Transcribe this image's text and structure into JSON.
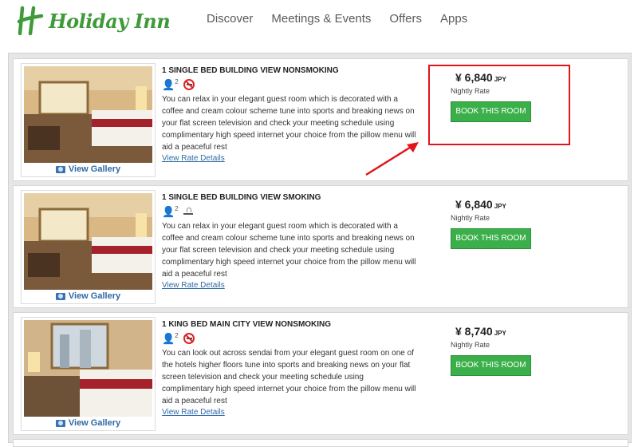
{
  "brand": {
    "name": "Holiday Inn",
    "color": "#3f9a3a"
  },
  "nav": [
    "Discover",
    "Meetings & Events",
    "Offers",
    "Apps"
  ],
  "rooms": [
    {
      "title": "1 SINGLE BED BUILDING VIEW NONSMOKING",
      "occupancy": "2",
      "smoking_icon": "no-smoking-icon",
      "description": "You can relax in your elegant guest room which is decorated with a coffee and cream colour scheme tune into sports and breaking news on your flat screen television and check your meeting schedule using complimentary high speed internet your choice from the pillow menu will aid a peaceful rest",
      "rate_link": "View Rate Details",
      "gallery": "View Gallery",
      "price": "¥ 6,840",
      "currency": "JPY",
      "price_note": "Nightly Rate",
      "book_label": "BOOK THIS ROOM"
    },
    {
      "title": "1 SINGLE BED BUILDING VIEW SMOKING",
      "occupancy": "2",
      "smoking_icon": "smoking-icon",
      "description": "You can relax in your elegant guest room which is decorated with a coffee and cream colour scheme tune into sports and breaking news on your flat screen television and check your meeting schedule using complimentary high speed internet your choice from the pillow menu will aid a peaceful rest",
      "rate_link": "View Rate Details",
      "gallery": "View Gallery",
      "price": "¥ 6,840",
      "currency": "JPY",
      "price_note": "Nightly Rate",
      "book_label": "BOOK THIS ROOM"
    },
    {
      "title": "1 KING BED MAIN CITY VIEW NONSMOKING",
      "occupancy": "2",
      "smoking_icon": "no-smoking-icon",
      "description": "You can look out across sendai from your elegant guest room on one of the hotels higher floors tune into sports and breaking news on your flat screen television and check your meeting schedule using complimentary high speed internet your choice from the pillow menu will aid a peaceful rest",
      "rate_link": "View Rate Details",
      "gallery": "View Gallery",
      "price": "¥ 8,740",
      "currency": "JPY",
      "price_note": "Nightly Rate",
      "book_label": "BOOK THIS ROOM"
    }
  ],
  "colors": {
    "accent_green": "#3bb04a",
    "link_blue": "#2f6aa7",
    "annotation_red": "#e0141b"
  }
}
